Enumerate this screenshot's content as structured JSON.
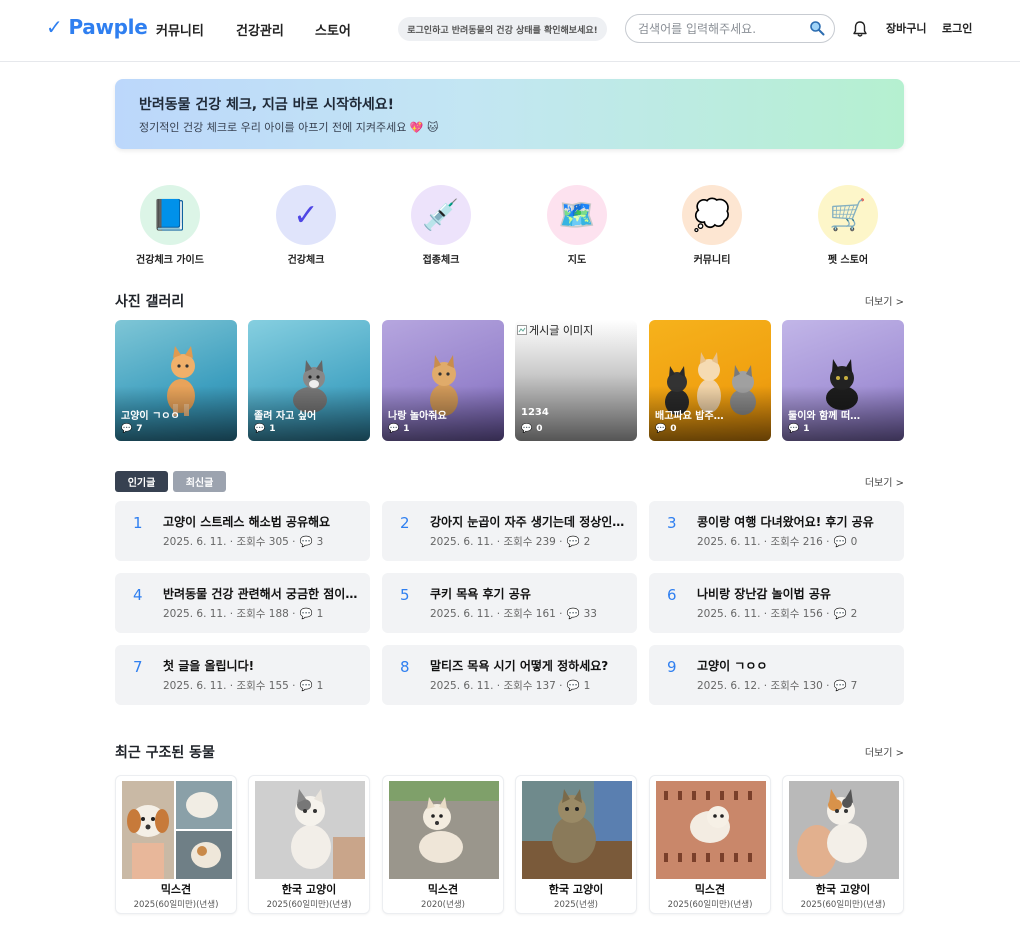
{
  "header": {
    "logo_text": "Pawple",
    "nav": [
      "커뮤니티",
      "건강관리",
      "스토어"
    ],
    "promo": "로그인하고 반려동물의 건강 상태를 확인해보세요!",
    "search_placeholder": "검색어를 입력해주세요.",
    "cart": "장바구니",
    "login": "로그인"
  },
  "banner": {
    "title": "반려동물 건강 체크, 지금 바로 시작하세요!",
    "subtitle": "정기적인 건강 체크로 우리 아이를 아프기 전에 지켜주세요 💖 🐱"
  },
  "quick_menu": [
    {
      "label": "건강체크 가이드",
      "icon": "book-icon",
      "glyph": "📘",
      "bg": "#dcf5e7"
    },
    {
      "label": "건강체크",
      "icon": "check-icon",
      "glyph": "✓",
      "bg": "#e0e4fb"
    },
    {
      "label": "접종체크",
      "icon": "syringe-icon",
      "glyph": "💉",
      "bg": "#ede3fb"
    },
    {
      "label": "지도",
      "icon": "map-icon",
      "glyph": "🗺️",
      "bg": "#fde2ef"
    },
    {
      "label": "커뮤니티",
      "icon": "speech-bubble-icon",
      "glyph": "💭",
      "bg": "#fde6d2"
    },
    {
      "label": "펫 스토어",
      "icon": "shopping-cart-icon",
      "glyph": "🛒",
      "bg": "#fdf6c9"
    }
  ],
  "gallery": {
    "title": "사진 갤러리",
    "more": "더보기 >",
    "items": [
      {
        "title": "고양이 ㄱㅇㅇ",
        "comments": "7"
      },
      {
        "title": "졸려 자고 싶어",
        "comments": "1"
      },
      {
        "title": "나랑 놀아줘요",
        "comments": "1"
      },
      {
        "title": "1234",
        "comments": "0",
        "broken_alt": "게시글 이미지"
      },
      {
        "title": "배고파요 밥주…",
        "comments": "0"
      },
      {
        "title": "둘이와 함께 떠…",
        "comments": "1"
      }
    ]
  },
  "posts": {
    "tabs": [
      "인기글",
      "최신글"
    ],
    "more": "더보기 >",
    "items": [
      {
        "num": "1",
        "title": "고양이 스트레스 해소법 공유해요",
        "meta": "2025. 6. 11. · 조회수 305 ·",
        "comments": "3"
      },
      {
        "num": "2",
        "title": "강아지 눈곱이 자주 생기는데 정상인…",
        "meta": "2025. 6. 11. · 조회수 239 ·",
        "comments": "2"
      },
      {
        "num": "3",
        "title": "콩이랑 여행 다녀왔어요! 후기 공유",
        "meta": "2025. 6. 11. · 조회수 216 ·",
        "comments": "0"
      },
      {
        "num": "4",
        "title": "반려동물 건강 관련해서 궁금한 점이 …",
        "meta": "2025. 6. 11. · 조회수 188 ·",
        "comments": "1"
      },
      {
        "num": "5",
        "title": "쿠키 목욕 후기 공유",
        "meta": "2025. 6. 11. · 조회수 161 ·",
        "comments": "33"
      },
      {
        "num": "6",
        "title": "나비랑 장난감 놀이법 공유",
        "meta": "2025. 6. 11. · 조회수 156 ·",
        "comments": "2"
      },
      {
        "num": "7",
        "title": "첫 글을 올립니다!",
        "meta": "2025. 6. 11. · 조회수 155 ·",
        "comments": "1"
      },
      {
        "num": "8",
        "title": "말티즈 목욕 시기 어떻게 정하세요?",
        "meta": "2025. 6. 11. · 조회수 137 ·",
        "comments": "1"
      },
      {
        "num": "9",
        "title": "고양이 ㄱㅇㅇ",
        "meta": "2025. 6. 12. · 조회수 130 ·",
        "comments": "7"
      }
    ]
  },
  "rescued": {
    "title": "최근 구조된 동물",
    "more": "더보기 >",
    "items": [
      {
        "breed": "믹스견",
        "year": "2025(60일미만)(년생)"
      },
      {
        "breed": "한국 고양이",
        "year": "2025(60일미만)(년생)"
      },
      {
        "breed": "믹스견",
        "year": "2020(년생)"
      },
      {
        "breed": "한국 고양이",
        "year": "2025(년생)"
      },
      {
        "breed": "믹스견",
        "year": "2025(60일미만)(년생)"
      },
      {
        "breed": "한국 고양이",
        "year": "2025(60일미만)(년생)"
      }
    ]
  },
  "colors": {
    "accent": "#2f7ff0",
    "tab_active": "#374151",
    "tab_inactive": "#9ca3af"
  }
}
